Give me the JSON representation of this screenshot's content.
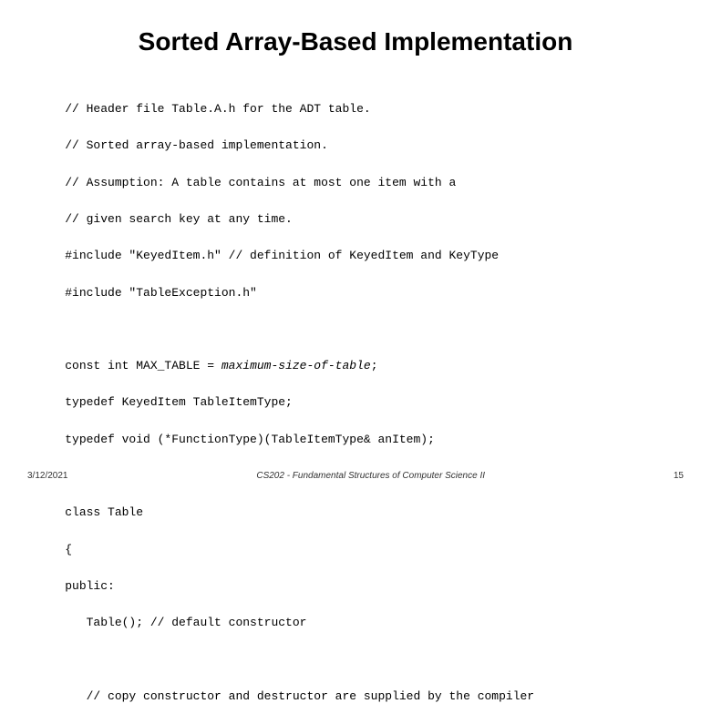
{
  "slide": {
    "title": "Sorted Array-Based Implementation",
    "code_lines": [
      {
        "id": "line1",
        "text": "// Header file Table.A.h for the ADT table."
      },
      {
        "id": "line2",
        "text": "// Sorted array-based implementation."
      },
      {
        "id": "line3",
        "text": "// Assumption: A table contains at most one item with a"
      },
      {
        "id": "line4",
        "text": "// given search key at any time."
      },
      {
        "id": "line5",
        "text": "#include \"KeyedItem.h\" // definition of KeyedItem and KeyType"
      },
      {
        "id": "line6",
        "text": "#include \"TableException.h\""
      },
      {
        "id": "line7",
        "text": ""
      },
      {
        "id": "line8",
        "text_parts": [
          {
            "text": "const int MAX_TABLE = ",
            "italic": false
          },
          {
            "text": "maximum-size-of-table",
            "italic": true
          },
          {
            "text": ";",
            "italic": false
          }
        ]
      },
      {
        "id": "line9",
        "text": "typedef KeyedItem TableItemType;"
      },
      {
        "id": "line10",
        "text": "typedef void (*FunctionType)(TableItemType& anItem);"
      },
      {
        "id": "line11",
        "text": ""
      },
      {
        "id": "line12",
        "text": "class Table"
      },
      {
        "id": "line13",
        "text": "{"
      },
      {
        "id": "line14",
        "text": "public:"
      },
      {
        "id": "line15",
        "text": "   Table(); // default constructor"
      },
      {
        "id": "line16",
        "text": ""
      },
      {
        "id": "line17",
        "text": "   // copy constructor and destructor are supplied by the compiler"
      }
    ],
    "footer": {
      "date": "3/12/2021",
      "course": "CS202 - Fundamental Structures of Computer Science II",
      "page": "15"
    }
  }
}
